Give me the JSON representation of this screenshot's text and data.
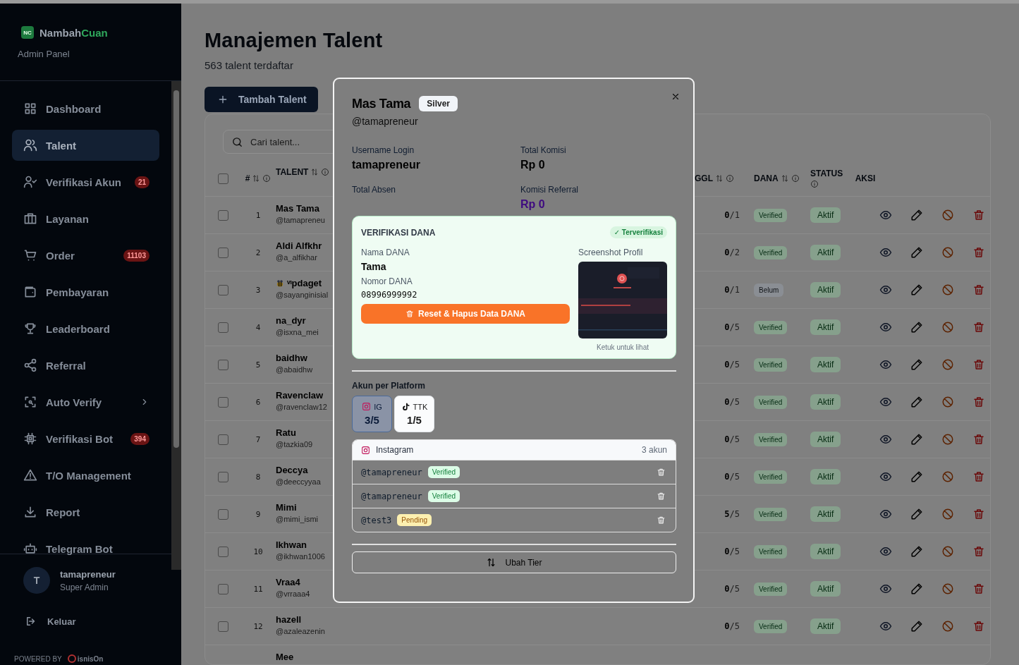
{
  "sidebar": {
    "brand": {
      "logo": "NC",
      "name": "Nambah",
      "accent": "Cuan",
      "subtitle": "Admin Panel"
    },
    "items": [
      {
        "label": "Dashboard",
        "selected": false
      },
      {
        "label": "Talent",
        "selected": true
      },
      {
        "label": "Verifikasi Akun",
        "selected": false,
        "badge": "21"
      },
      {
        "label": "Layanan",
        "selected": false
      },
      {
        "label": "Order",
        "selected": false,
        "badge": "11103"
      },
      {
        "label": "Pembayaran",
        "selected": false
      },
      {
        "label": "Leaderboard",
        "selected": false
      },
      {
        "label": "Referral",
        "selected": false
      },
      {
        "label": "Auto Verify",
        "selected": false,
        "submenu": true
      },
      {
        "label": "Verifikasi Bot",
        "selected": false,
        "badge": "394"
      },
      {
        "label": "T/O Management",
        "selected": false
      },
      {
        "label": "Report",
        "selected": false
      },
      {
        "label": "Telegram Bot",
        "selected": false
      }
    ],
    "user": {
      "initial": "T",
      "name": "tamapreneur",
      "role": "Super Admin"
    },
    "logout": "Keluar",
    "powered_by": "POWERED BY",
    "powered_logo": "isnisOn"
  },
  "page": {
    "title": "Manajemen Talent",
    "subtitle": "563 talent terdaftar",
    "add_button": "Tambah Talent",
    "search": {
      "placeholder": "Cari talent..."
    }
  },
  "table": {
    "all_selected": false,
    "columns": [
      {
        "label": "#",
        "sortable": true
      },
      {
        "label": "TALENT",
        "sortable": true
      },
      {
        "label": "GGL",
        "sortable": true
      },
      {
        "label": "DANA",
        "sortable": true
      },
      {
        "label": "STATUS",
        "sortable": false
      },
      {
        "label": "AKSI",
        "sortable": false
      }
    ],
    "rows": [
      {
        "selected": false,
        "number": "1",
        "name": "Mas Tama",
        "handle": "@tamapreneu",
        "ggl": "0/1",
        "dana": {
          "label": "Verified",
          "verified": true
        },
        "status": {
          "label": "Aktif",
          "active": true
        }
      },
      {
        "selected": false,
        "number": "2",
        "name": "Aldi Alfkhr",
        "handle": "@a_alfikhar",
        "ggl": "0/2",
        "dana": {
          "label": "Verified",
          "verified": true
        },
        "status": {
          "label": "Aktif",
          "active": true
        }
      },
      {
        "selected": false,
        "number": "3",
        "name": "ᵛᶦpdaget",
        "name_icon": true,
        "handle": "@sayanginisial",
        "ggl": "0/1",
        "dana": {
          "label": "Belum",
          "verified": false
        },
        "status": {
          "label": "Aktif",
          "active": true
        }
      },
      {
        "selected": false,
        "number": "4",
        "name": "na_dyr",
        "handle": "@isxna_mei",
        "ggl": "0/5",
        "dana": {
          "label": "Verified",
          "verified": true
        },
        "status": {
          "label": "Aktif",
          "active": true
        }
      },
      {
        "selected": false,
        "number": "5",
        "name": "baidhw",
        "handle": "@abaidhw",
        "ggl": "0/5",
        "dana": {
          "label": "Verified",
          "verified": true
        },
        "status": {
          "label": "Aktif",
          "active": true
        }
      },
      {
        "selected": false,
        "number": "6",
        "name": "Ravenclaw",
        "handle": "@ravenclaw12",
        "ggl": "0/5",
        "dana": {
          "label": "Verified",
          "verified": true
        },
        "status": {
          "label": "Aktif",
          "active": true
        }
      },
      {
        "selected": false,
        "number": "7",
        "name": "Ratu",
        "handle": "@tazkia09",
        "ggl": "0/5",
        "dana": {
          "label": "Verified",
          "verified": true
        },
        "status": {
          "label": "Aktif",
          "active": true
        }
      },
      {
        "selected": false,
        "number": "8",
        "name": "Deccya",
        "handle": "@deeccyyaa",
        "ggl": "0/5",
        "dana": {
          "label": "Verified",
          "verified": true
        },
        "status": {
          "label": "Aktif",
          "active": true
        }
      },
      {
        "selected": false,
        "number": "9",
        "name": "Mimi",
        "handle": "@mimi_ismi",
        "ggl": "5/5",
        "dana": {
          "label": "Verified",
          "verified": true
        },
        "status": {
          "label": "Aktif",
          "active": true
        }
      },
      {
        "selected": false,
        "number": "10",
        "name": "Ikhwan",
        "handle": "@ikhwan1006",
        "ggl": "0/5",
        "dana": {
          "label": "Verified",
          "verified": true
        },
        "status": {
          "label": "Aktif",
          "active": true
        }
      },
      {
        "selected": false,
        "number": "11",
        "name": "Vraa4",
        "handle": "@vrraaa4",
        "ggl": "0/5",
        "dana": {
          "label": "Verified",
          "verified": true
        },
        "status": {
          "label": "Aktif",
          "active": true
        }
      },
      {
        "selected": false,
        "number": "12",
        "name": "hazell",
        "handle": "@azaleazenin",
        "ggl": "0/5",
        "dana": {
          "label": "Verified",
          "verified": true
        },
        "status": {
          "label": "Aktif",
          "active": true
        }
      },
      {
        "name": "Mee"
      }
    ]
  },
  "modal": {
    "name": "Mas Tama",
    "tier": "Silver",
    "handle": "@tamapreneur",
    "info": [
      {
        "label": "Username Login",
        "value": "tamapreneur"
      },
      {
        "label": "Total Komisi",
        "value": "Rp 0"
      },
      {
        "label": "Total Absen"
      },
      {
        "label": "Komisi Referral",
        "value": "Rp 0",
        "highlight": true
      }
    ],
    "dana": {
      "title": "VERIFIKASI DANA",
      "status": "✓ Terverifikasi",
      "verified": true,
      "fields": [
        {
          "label": "Nama DANA",
          "value": "Tama",
          "kind": "text"
        },
        {
          "label": "Nomor DANA",
          "value": "08996999992",
          "kind": "number"
        }
      ],
      "reset_button": "Reset & Hapus Data DANA",
      "screenshot_label": "Screenshot Profil",
      "screenshot_hint": "Ketuk untuk lihat"
    },
    "platforms_label": "Akun per Platform",
    "platforms": [
      {
        "code": "IG",
        "count": "3/5",
        "kind": "instagram",
        "selected": true
      },
      {
        "code": "TTK",
        "count": "1/5",
        "kind": "tiktok",
        "selected": false
      }
    ],
    "account_group": {
      "kind": "instagram",
      "title": "Instagram",
      "count": "3 akun",
      "accounts": [
        {
          "handle": "@tamapreneur",
          "status": "Verified",
          "kind": "verified"
        },
        {
          "handle": "@tamapreneur",
          "status": "Verified",
          "kind": "verified"
        },
        {
          "handle": "@test3",
          "status": "Pending",
          "kind": "pending"
        }
      ]
    },
    "tier_button": "Ubah Tier"
  }
}
